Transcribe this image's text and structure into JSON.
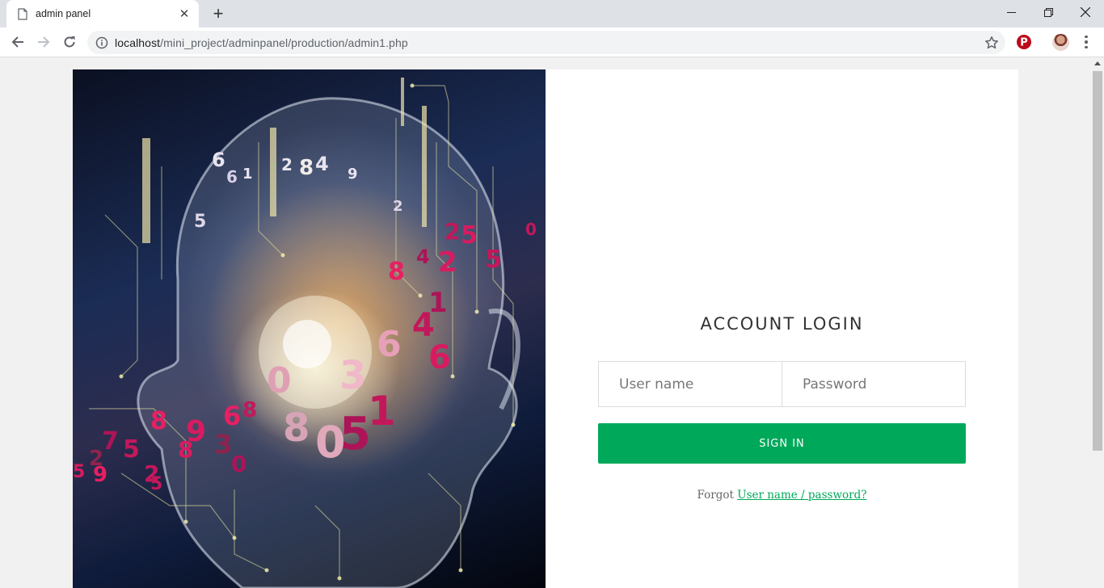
{
  "browser": {
    "tab": {
      "title": "admin panel",
      "close_glyph": "✕"
    },
    "new_tab_glyph": "+",
    "window_controls": {
      "minimize": "minimize-icon",
      "restore": "restore-icon",
      "close": "close-icon"
    },
    "address": {
      "host": "localhost",
      "path": "/mini_project/adminpanel/production/admin1.php"
    },
    "extensions": [
      "pinterest-icon"
    ],
    "accent_colors": {
      "pinterest": "#bd081c"
    }
  },
  "page": {
    "hero_image": "ai-head-numbers-illustration",
    "login": {
      "title": "ACCOUNT LOGIN",
      "username_placeholder": "User name",
      "password_placeholder": "Password",
      "signin_label": "SIGN IN",
      "forgot_prefix": "Forgot",
      "forgot_link": "User name / password?"
    },
    "colors": {
      "primary": "#00a85a",
      "card_bg": "#ffffff",
      "page_bg": "#f1f1f1"
    }
  }
}
